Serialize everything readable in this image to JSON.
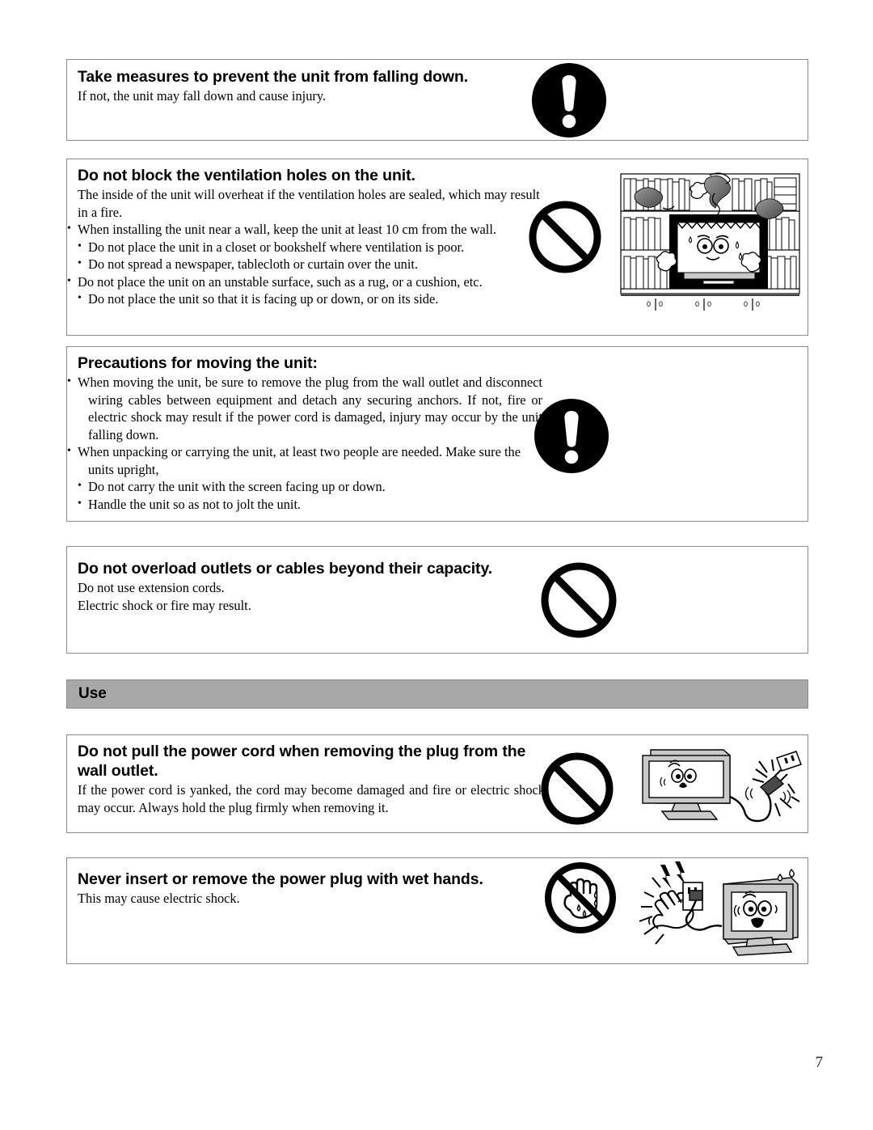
{
  "page": {
    "number": "7",
    "background_color": "#ffffff",
    "box_border_color": "#8a8a8a"
  },
  "section_bar": {
    "label": "Use",
    "background_color": "#a8a8a8"
  },
  "panels": [
    {
      "id": "falling-down",
      "heading": "Take measures to prevent the unit from falling down.",
      "body": "If not, the unit may fall down and cause injury.",
      "icon": "exclamation-circle-icon"
    },
    {
      "id": "ventilation-holes",
      "heading": "Do not block the ventilation holes on the unit.",
      "body": "The inside of the unit will overheat if the ventilation holes are sealed, which may result in a fire.",
      "bullets": [
        "When installing the unit near a wall, keep the unit at least 10 cm from the wall.",
        "Do not place the unit in a closet or bookshelf where ventilation is poor.",
        "Do not spread a newspaper, tablecloth or curtain over the unit.",
        "Do not place the unit on an unstable surface, such as a rug, or a cushion, etc.",
        "Do not place the unit so that it is facing up or down, or on its side."
      ],
      "icon": "prohibition-icon",
      "illustration": "tv-in-bookshelf-overheating-illustration"
    },
    {
      "id": "moving-the-unit",
      "heading": "Precautions for moving the unit:",
      "bullets": [
        "When moving the unit, be sure to remove the plug from the wall outlet and disconnect wiring cables between equipment and detach any securing anchors. If not, fire or electric shock may result if the power cord is damaged, injury may occur by the unit falling down.",
        "When unpacking or carrying the unit, at least two people are needed. Make sure the units upright,",
        "Do not carry the unit with the screen facing up or down.",
        "Handle the unit so as not to jolt the unit."
      ],
      "icon": "exclamation-circle-icon"
    },
    {
      "id": "overload-outlets",
      "heading": "Do not overload outlets or cables beyond their capacity.",
      "body_lines": [
        "Do not use extension cords.",
        "Electric shock or fire may result."
      ],
      "icon": "prohibition-icon"
    },
    {
      "id": "power-cord-pull",
      "heading": "Do not pull the power cord when removing the plug from the wall outlet.",
      "body": "If the power cord is yanked, the cord may become damaged and fire or electric shock may occur. Always hold the plug firmly when removing it.",
      "icon": "prohibition-icon",
      "illustration": "tv-with-yanked-power-cord-illustration"
    },
    {
      "id": "wet-hands",
      "heading": "Never insert or remove the power plug with wet hands.",
      "body": "This may cause electric shock.",
      "icon": "no-wet-hands-icon",
      "illustration": "wet-hand-electric-shock-illustration"
    }
  ]
}
